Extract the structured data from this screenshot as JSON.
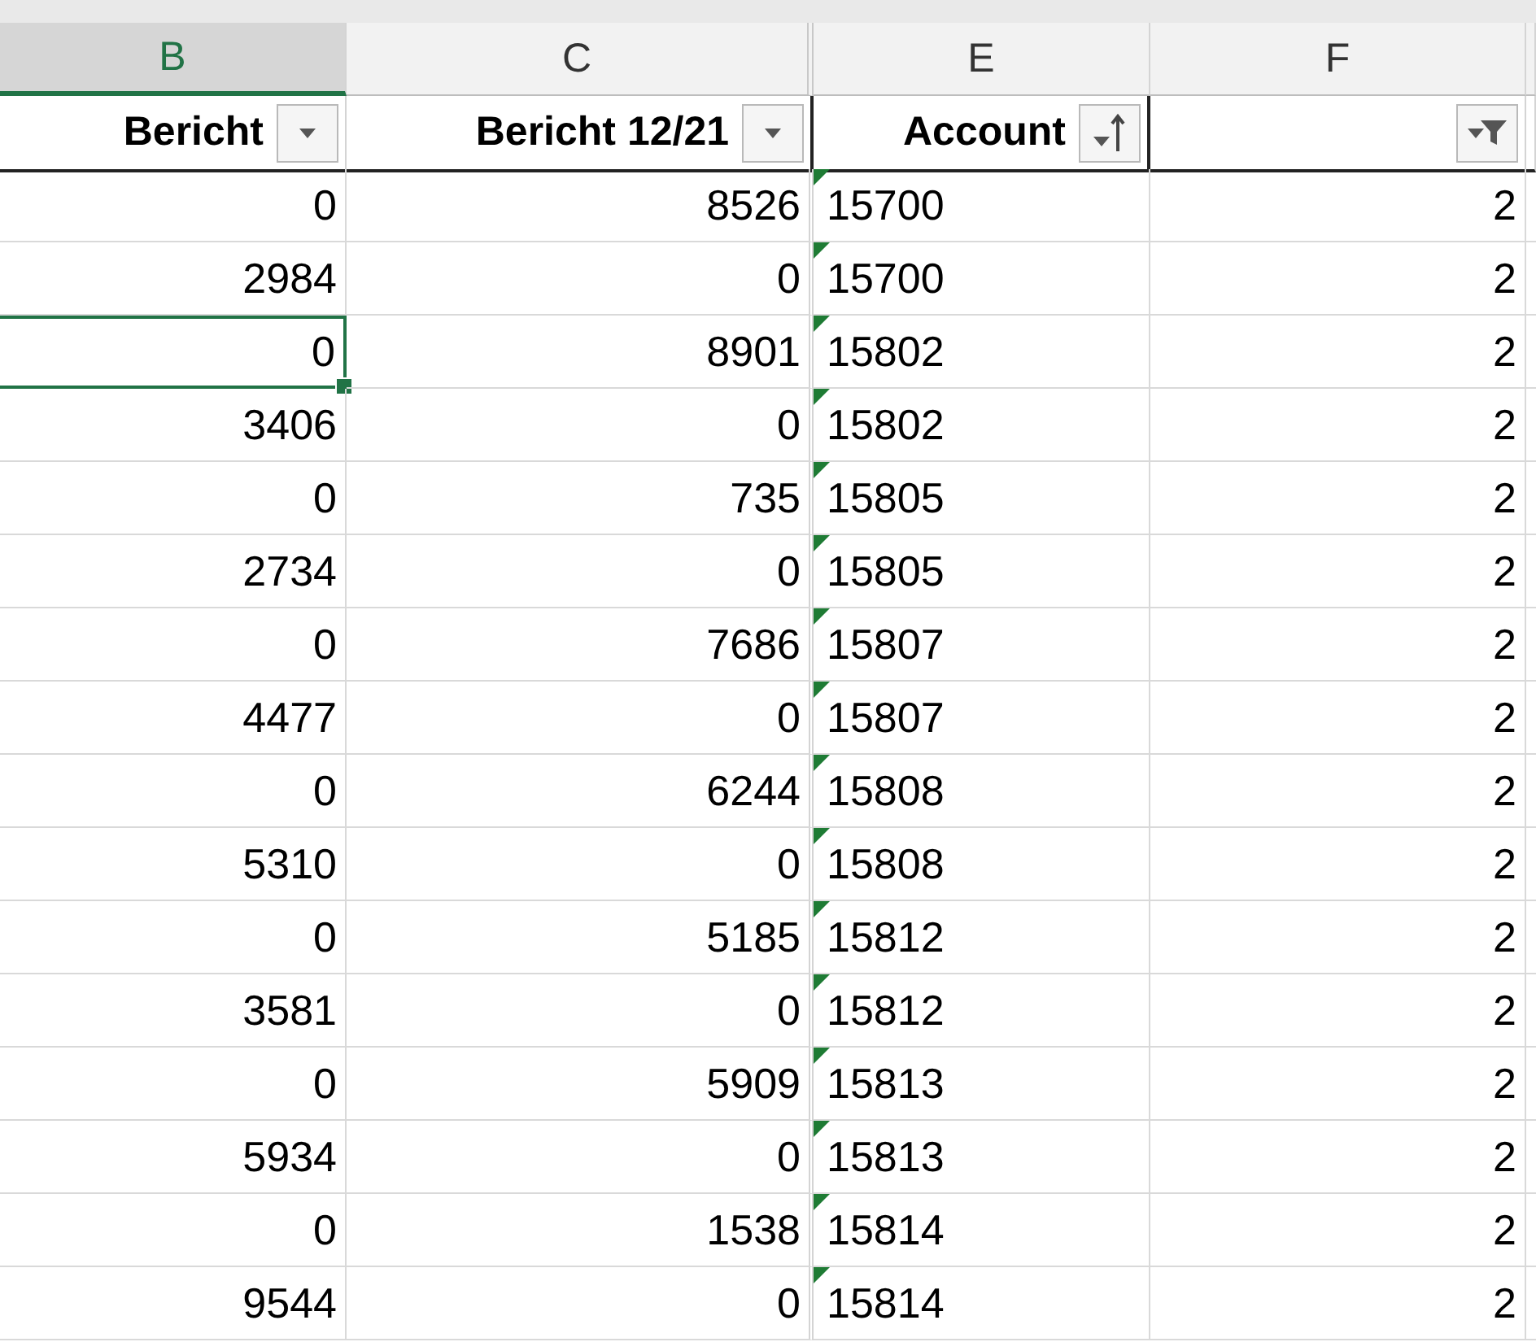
{
  "column_letters": [
    {
      "label": "B",
      "selected": true
    },
    {
      "label": "C",
      "selected": false
    },
    {
      "label": "E",
      "selected": false
    },
    {
      "label": "F",
      "selected": false
    }
  ],
  "header": [
    {
      "label": "Bericht",
      "kind": "dropdown"
    },
    {
      "label": "Bericht 12/21",
      "kind": "dropdown"
    },
    {
      "label": "Account",
      "kind": "sorted"
    },
    {
      "kind": "filtered"
    }
  ],
  "rows": [
    {
      "b": "0",
      "c": "8526",
      "e": "15700",
      "f": "2",
      "selected": false
    },
    {
      "b": "2984",
      "c": "0",
      "e": "15700",
      "f": "2",
      "selected": false
    },
    {
      "b": "0",
      "c": "8901",
      "e": "15802",
      "f": "2",
      "selected": true
    },
    {
      "b": "3406",
      "c": "0",
      "e": "15802",
      "f": "2",
      "selected": false
    },
    {
      "b": "0",
      "c": "735",
      "e": "15805",
      "f": "2",
      "selected": false
    },
    {
      "b": "2734",
      "c": "0",
      "e": "15805",
      "f": "2",
      "selected": false
    },
    {
      "b": "0",
      "c": "7686",
      "e": "15807",
      "f": "2",
      "selected": false
    },
    {
      "b": "4477",
      "c": "0",
      "e": "15807",
      "f": "2",
      "selected": false
    },
    {
      "b": "0",
      "c": "6244",
      "e": "15808",
      "f": "2",
      "selected": false
    },
    {
      "b": "5310",
      "c": "0",
      "e": "15808",
      "f": "2",
      "selected": false
    },
    {
      "b": "0",
      "c": "5185",
      "e": "15812",
      "f": "2",
      "selected": false
    },
    {
      "b": "3581",
      "c": "0",
      "e": "15812",
      "f": "2",
      "selected": false
    },
    {
      "b": "0",
      "c": "5909",
      "e": "15813",
      "f": "2",
      "selected": false
    },
    {
      "b": "5934",
      "c": "0",
      "e": "15813",
      "f": "2",
      "selected": false
    },
    {
      "b": "0",
      "c": "1538",
      "e": "15814",
      "f": "2",
      "selected": false
    },
    {
      "b": "9544",
      "c": "0",
      "e": "15814",
      "f": "2",
      "selected": false
    }
  ]
}
